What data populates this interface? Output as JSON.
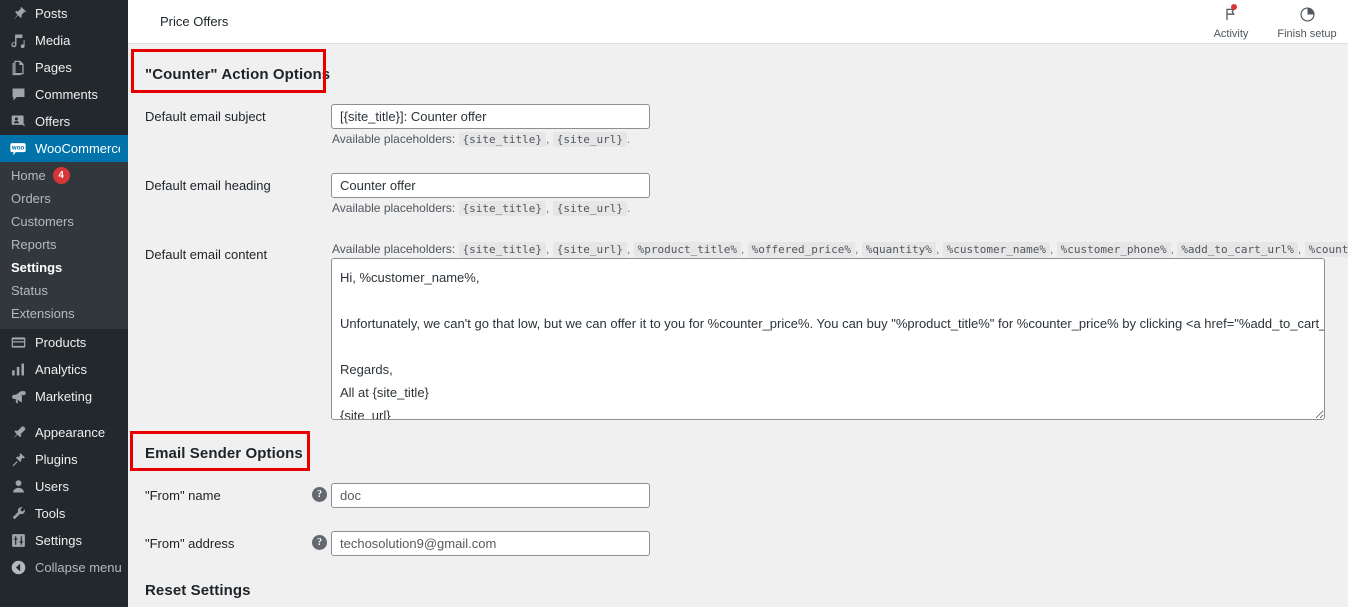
{
  "sidebar": {
    "items": [
      {
        "label": "Posts",
        "icon": "pin-icon",
        "name": "posts"
      },
      {
        "label": "Media",
        "icon": "media-icon",
        "name": "media"
      },
      {
        "label": "Pages",
        "icon": "pages-icon",
        "name": "pages"
      },
      {
        "label": "Comments",
        "icon": "comments-icon",
        "name": "comments"
      },
      {
        "label": "Offers",
        "icon": "offers-icon",
        "name": "offers"
      },
      {
        "label": "WooCommerce",
        "icon": "woocommerce-icon",
        "name": "woocommerce",
        "current": true
      }
    ],
    "submenu": [
      {
        "label": "Home",
        "badge": "4"
      },
      {
        "label": "Orders"
      },
      {
        "label": "Customers"
      },
      {
        "label": "Reports"
      },
      {
        "label": "Settings",
        "active": true
      },
      {
        "label": "Status"
      },
      {
        "label": "Extensions"
      }
    ],
    "items_lower": [
      {
        "label": "Products",
        "icon": "products-icon",
        "name": "products"
      },
      {
        "label": "Analytics",
        "icon": "analytics-icon",
        "name": "analytics"
      },
      {
        "label": "Marketing",
        "icon": "marketing-icon",
        "name": "marketing"
      }
    ],
    "items_bottom": [
      {
        "label": "Appearance",
        "icon": "appearance-icon",
        "name": "appearance"
      },
      {
        "label": "Plugins",
        "icon": "plugins-icon",
        "name": "plugins"
      },
      {
        "label": "Users",
        "icon": "users-icon",
        "name": "users"
      },
      {
        "label": "Tools",
        "icon": "tools-icon",
        "name": "tools"
      },
      {
        "label": "Settings",
        "icon": "settings-icon",
        "name": "settings"
      }
    ],
    "collapse": {
      "label": "Collapse menu",
      "icon": "collapse-icon"
    },
    "accent_color": "#0073aa",
    "background_color": "#23282d",
    "badge_color": "#d63638"
  },
  "header": {
    "title": "Price Offers",
    "actions": [
      {
        "label": "Activity",
        "icon": "flag-icon",
        "has_dot": true
      },
      {
        "label": "Finish setup",
        "icon": "progress-circle-icon",
        "has_dot": false
      }
    ]
  },
  "main": {
    "section_counter": {
      "heading": "\"Counter\" Action Options",
      "highlight_color": "#e80000",
      "fields": [
        {
          "label": "Default email subject",
          "value": "[{site_title}]: Counter offer",
          "placeholders_prefix": "Available placeholders:",
          "placeholders": [
            "{site_title}",
            "{site_url}"
          ]
        },
        {
          "label": "Default email heading",
          "value": "Counter offer",
          "placeholders_prefix": "Available placeholders:",
          "placeholders": [
            "{site_title}",
            "{site_url}"
          ]
        }
      ],
      "content_field": {
        "label": "Default email content",
        "placeholders_prefix": "Available placeholders:",
        "placeholders": [
          "{site_title}",
          "{site_url}",
          "%product_title%",
          "%offered_price%",
          "%quantity%",
          "%customer_name%",
          "%customer_phone%",
          "%add_to_cart_url%",
          "%counter_price%"
        ],
        "value": "Hi, %customer_name%,\n\nUnfortunately, we can't go that low, but we can offer it to you for %counter_price%. You can buy \"%product_title%\" for %counter_price% by clicking <a href=\"%add_to_cart_url%\">this link</a>.\n\nRegards,\nAll at {site_title}\n{site_url}"
      }
    },
    "section_sender": {
      "heading": "Email Sender Options",
      "highlight_color": "#e80000",
      "fields": [
        {
          "label": "\"From\" name",
          "value": "doc",
          "help": "?"
        },
        {
          "label": "\"From\" address",
          "value": "techosolution9@gmail.com",
          "help": "?"
        }
      ]
    },
    "section_reset": {
      "heading": "Reset Settings"
    }
  }
}
